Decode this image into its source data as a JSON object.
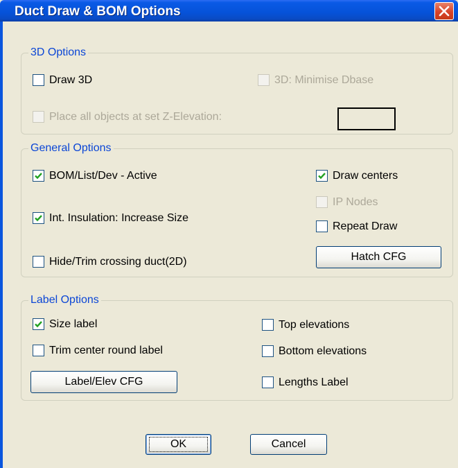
{
  "window": {
    "title": "Duct Draw & BOM Options"
  },
  "colors": {
    "titlebar": "#0652d8",
    "close": "#d8432a",
    "legend": "#0b46d6",
    "background": "#ece9d8"
  },
  "groups": {
    "options_3d": {
      "legend": "3D Options",
      "draw_3d": {
        "label": "Draw 3D",
        "checked": false,
        "enabled": true
      },
      "minimise_dbase": {
        "label": "3D: Minimise Dbase",
        "checked": false,
        "enabled": false
      },
      "set_z_elevation": {
        "label": "Place all objects at set Z-Elevation:",
        "checked": false,
        "enabled": false
      },
      "z_elevation_value": ""
    },
    "general": {
      "legend": "General Options",
      "bom_active": {
        "label": "BOM/List/Dev - Active",
        "checked": true,
        "enabled": true
      },
      "int_insulation": {
        "label": "Int. Insulation: Increase Size",
        "checked": true,
        "enabled": true
      },
      "hide_trim": {
        "label": "Hide/Trim crossing duct(2D)",
        "checked": false,
        "enabled": true
      },
      "draw_centers": {
        "label": "Draw centers",
        "checked": true,
        "enabled": true
      },
      "ip_nodes": {
        "label": "IP Nodes",
        "checked": false,
        "enabled": false
      },
      "repeat_draw": {
        "label": "Repeat Draw",
        "checked": false,
        "enabled": true
      },
      "hatch_cfg_button": "Hatch CFG"
    },
    "label": {
      "legend": "Label Options",
      "size_label": {
        "label": "Size label",
        "checked": true,
        "enabled": true
      },
      "trim_center": {
        "label": "Trim center round label",
        "checked": false,
        "enabled": true
      },
      "top_elevations": {
        "label": "Top elevations",
        "checked": false,
        "enabled": true
      },
      "bottom_elevations": {
        "label": "Bottom elevations",
        "checked": false,
        "enabled": true
      },
      "lengths_label": {
        "label": "Lengths Label",
        "checked": false,
        "enabled": true
      },
      "label_elev_cfg_button": "Label/Elev CFG"
    }
  },
  "buttons": {
    "ok": "OK",
    "cancel": "Cancel"
  },
  "icons": {
    "close": "close-icon",
    "check": "checkmark-icon"
  }
}
